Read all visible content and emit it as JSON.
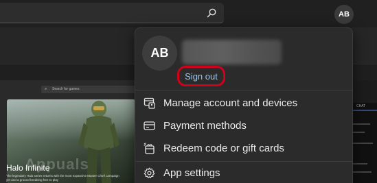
{
  "account": {
    "initials": "AB",
    "sign_out_label": "Sign out"
  },
  "menu": {
    "items": [
      {
        "label": "Manage account and devices",
        "icon": "manage-account-icon"
      },
      {
        "label": "Payment methods",
        "icon": "payment-card-icon"
      },
      {
        "label": "Redeem code or gift cards",
        "icon": "gift-card-icon"
      },
      {
        "label": "App settings",
        "icon": "gear-icon"
      }
    ]
  },
  "background": {
    "mini_search_placeholder": "Search for games",
    "featured_title": "Halo Infinite",
    "featured_description": "The legendary Halo series returns with the most expansive Master Chief campaign yet and a ground-breaking free to play",
    "watermark": "Appuals",
    "right_tab": "CHAT"
  },
  "colors": {
    "highlight_border": "#d0021b",
    "link_text": "#9ac7f0",
    "flyout_bg": "#2b2b2b"
  }
}
